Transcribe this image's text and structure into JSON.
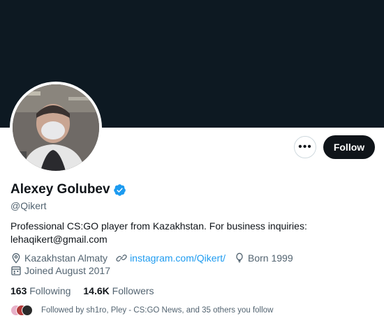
{
  "profile": {
    "name": "Alexey Golubev",
    "handle": "@Qikert",
    "bio": "Professional CS:GO player from Kazakhstan. For business inquiries: lehaqikert@gmail.com",
    "location": "Kazakhstan Almaty",
    "link": "instagram.com/Qikert/",
    "born": "Born 1999",
    "joined": "Joined August 2017"
  },
  "stats": {
    "following_count": "163",
    "following_label": "Following",
    "followers_count": "14.6K",
    "followers_label": "Followers"
  },
  "followed_by": "Followed by sh1ro, Pley - CS:GO News, and 35 others you follow",
  "actions": {
    "more_label": "•••",
    "follow_label": "Follow"
  },
  "colors": {
    "banner": "#0d1922",
    "link": "#1d9bf0",
    "verified": "#1d9bf0",
    "follow_button": "#0f1419"
  },
  "icons": [
    "verified-badge-icon",
    "location-pin-icon",
    "link-icon",
    "birthday-balloon-icon",
    "calendar-icon"
  ]
}
